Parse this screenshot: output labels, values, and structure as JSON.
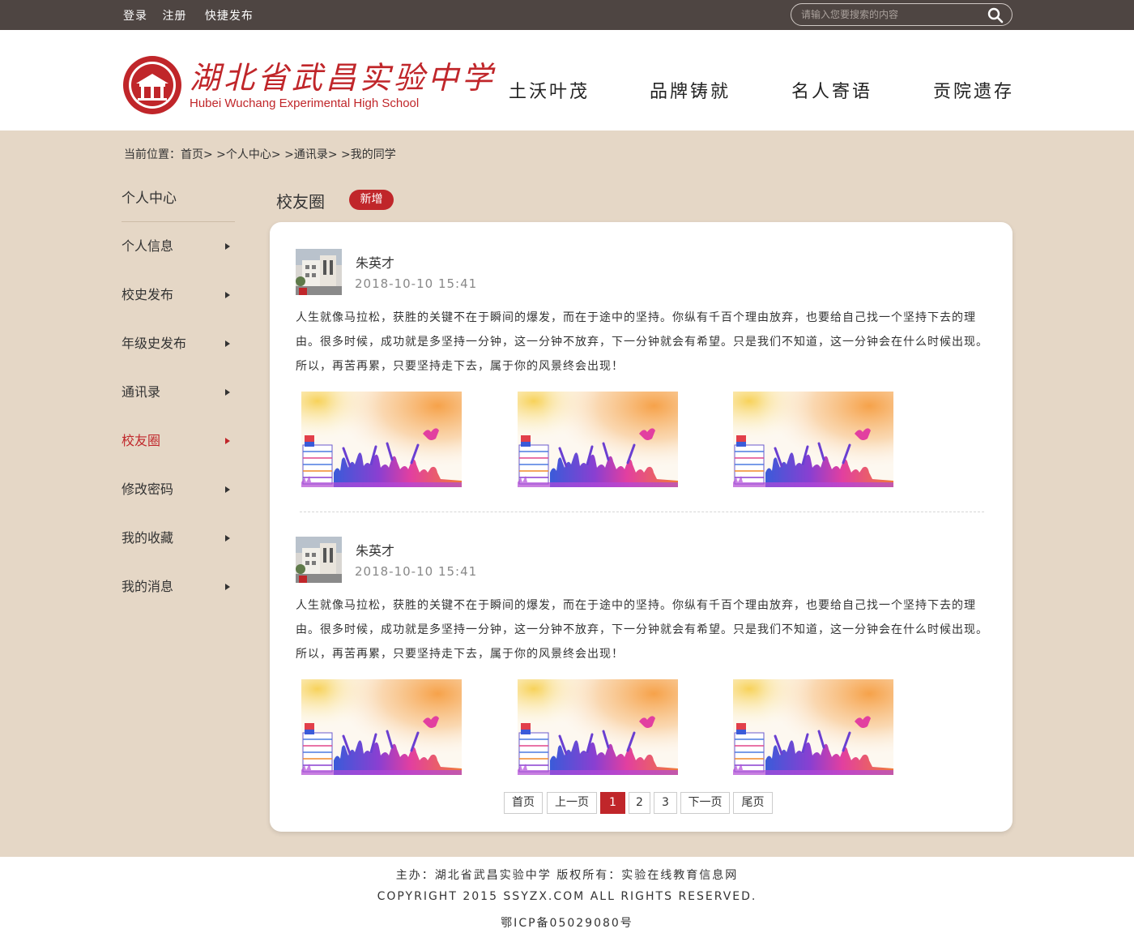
{
  "topbar": {
    "login": "登录",
    "register": "注册",
    "quick_publish": "快捷发布",
    "search_placeholder": "请输入您要搜索的内容"
  },
  "logo": {
    "name_cn": "湖北省武昌实验中学",
    "name_en": "Hubei Wuchang Experimental High School"
  },
  "nav": [
    "土沃叶茂",
    "品牌铸就",
    "名人寄语",
    "贡院遗存"
  ],
  "breadcrumb": {
    "prefix": "当前位置：",
    "items": [
      "首页",
      "个人中心",
      "通讯录",
      "我的同学"
    ],
    "separator": "> >"
  },
  "sidebar": {
    "title": "个人中心",
    "items": [
      "个人信息",
      "校史发布",
      "年级史发布",
      "通讯录",
      "校友圈",
      "修改密码",
      "我的收藏",
      "我的消息"
    ],
    "active": "校友圈"
  },
  "section": {
    "title": "校友圈",
    "add_label": "新增"
  },
  "posts": [
    {
      "author": "朱英才",
      "time": "2018-10-10 15:41",
      "text": "人生就像马拉松，获胜的关键不在于瞬间的爆发，而在于途中的坚持。你纵有千百个理由放弃，也要给自己找一个坚持下去的理由。很多时候，成功就是多坚持一分钟，这一分钟不放弃，下一分钟就会有希望。只是我们不知道，这一分钟会在什么时候出现。所以，再苦再累，只要坚持走下去，属于你的风景终会出现！"
    },
    {
      "author": "朱英才",
      "time": "2018-10-10 15:41",
      "text": "人生就像马拉松，获胜的关键不在于瞬间的爆发，而在于途中的坚持。你纵有千百个理由放弃，也要给自己找一个坚持下去的理由。很多时候，成功就是多坚持一分钟，这一分钟不放弃，下一分钟就会有希望。只是我们不知道，这一分钟会在什么时候出现。所以，再苦再累，只要坚持走下去，属于你的风景终会出现！"
    }
  ],
  "pager": {
    "first": "首页",
    "prev": "上一页",
    "pages": [
      "1",
      "2",
      "3"
    ],
    "current": "1",
    "next": "下一页",
    "last": "尾页"
  },
  "footer": {
    "line1": "主办：湖北省武昌实验中学  版权所有：实验在线教育信息网",
    "line2": "COPYRIGHT 2015 SSYZX.COM ALL RIGHTS RESERVED.",
    "line3": "鄂ICP备05029080号"
  },
  "colors": {
    "accent": "#c0262a",
    "topbar_bg": "#4e4542",
    "page_bg": "#e5d7c6"
  }
}
